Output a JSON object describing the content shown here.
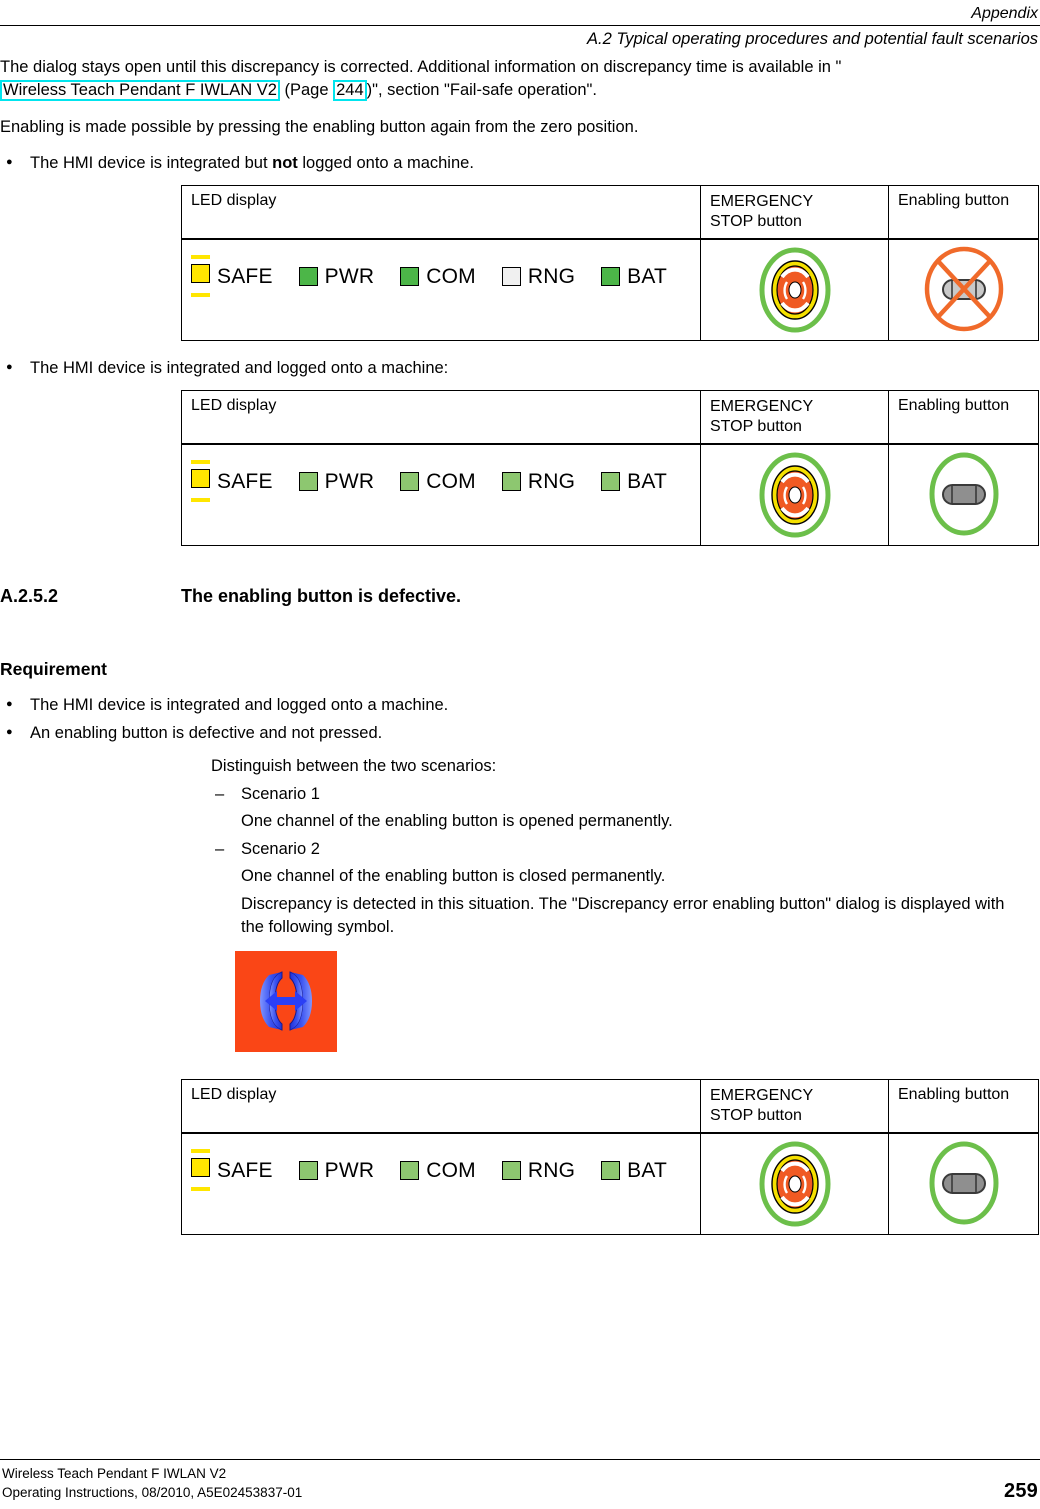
{
  "header": {
    "chapter": "Appendix",
    "section": "A.2 Typical operating procedures and potential fault scenarios"
  },
  "footer": {
    "doc_title": "Wireless Teach Pendant F IWLAN V2",
    "doc_info": "Operating Instructions, 08/2010, A5E02453837-01",
    "page_number": "259"
  },
  "body": {
    "para1_a": "The dialog stays open until this discrepancy is corrected. Additional information on discrepancy time is available in \"",
    "para1_link1": "Wireless Teach Pendant F IWLAN V2",
    "para1_b": " (Page ",
    "para1_link2": "244",
    "para1_c": ")\", section \"Fail-safe operation\".",
    "para2": "Enabling is made possible by pressing the enabling button again from the zero position.",
    "bullet1_a": "The HMI device is integrated but ",
    "bullet1_bold": "not",
    "bullet1_b": " logged onto a machine.",
    "bullet2": "The HMI device is integrated and logged onto a machine:"
  },
  "section_heading": {
    "number": "A.2.5.2",
    "title": "The enabling button is defective."
  },
  "requirement": {
    "heading": "Requirement",
    "bullet1": "The HMI device is integrated and logged onto a machine.",
    "bullet2": "An enabling button is defective and not pressed.",
    "intro": "Distinguish between the two scenarios:",
    "scenario1_label": "Scenario 1",
    "scenario1_text": "One channel of the enabling button is opened permanently.",
    "scenario2_label": "Scenario 2",
    "scenario2_text": "One channel of the enabling button is closed permanently.",
    "discrepancy_text": "Discrepancy is detected in this situation. The \"Discrepancy error enabling button\" dialog is displayed with the following symbol."
  },
  "table_headers": {
    "led_display": "LED display",
    "estop": "EMERGENCY STOP button",
    "estop_line1": "EMERGENCY",
    "estop_line2": "STOP button",
    "enabling": "Enabling button"
  },
  "tables": [
    {
      "id": "table-not-logged-on",
      "leds": [
        {
          "label": "SAFE",
          "color": "#ffe600",
          "blinking": true
        },
        {
          "label": "PWR",
          "color": "#4cb648",
          "blinking": false
        },
        {
          "label": "COM",
          "color": "#4cb648",
          "blinking": false
        },
        {
          "label": "RNG",
          "color": "#f0f0f0",
          "blinking": false
        },
        {
          "label": "BAT",
          "color": "#4cb648",
          "blinking": false
        }
      ],
      "estop_state": "active",
      "enabling_state": "disabled-crossed"
    },
    {
      "id": "table-logged-on",
      "leds": [
        {
          "label": "SAFE",
          "color": "#ffe600",
          "blinking": true
        },
        {
          "label": "PWR",
          "color": "#8dc770",
          "blinking": false
        },
        {
          "label": "COM",
          "color": "#8dc770",
          "blinking": false
        },
        {
          "label": "RNG",
          "color": "#8dc770",
          "blinking": false
        },
        {
          "label": "BAT",
          "color": "#8dc770",
          "blinking": false
        }
      ],
      "estop_state": "active",
      "enabling_state": "enabled"
    },
    {
      "id": "table-defective-enabling",
      "leds": [
        {
          "label": "SAFE",
          "color": "#ffe600",
          "blinking": true
        },
        {
          "label": "PWR",
          "color": "#8dc770",
          "blinking": false
        },
        {
          "label": "COM",
          "color": "#8dc770",
          "blinking": false
        },
        {
          "label": "RNG",
          "color": "#8dc770",
          "blinking": false
        },
        {
          "label": "BAT",
          "color": "#8dc770",
          "blinking": false
        }
      ],
      "estop_state": "active",
      "enabling_state": "enabled"
    }
  ],
  "colors": {
    "link_border": "#00e5ee",
    "blink_bar": "#ffe600",
    "led_green": "#4cb648",
    "led_green_light": "#8dc770",
    "led_yellow": "#ffe600",
    "led_off": "#f0f0f0",
    "estop_ring_green": "#6cbf4a",
    "estop_ring_yellow": "#f5e000",
    "estop_body_orange": "#f05a23",
    "symbol_bg_orange": "#fa4616",
    "symbol_blue": "#2b3ff5",
    "cross_orange": "#f06a2a",
    "pill_gray": "#9b9b9b"
  },
  "symbol": {
    "name": "discrepancy-error-enabling-button-symbol",
    "background": "#fa4616",
    "foreground": "#2b3ff5"
  }
}
